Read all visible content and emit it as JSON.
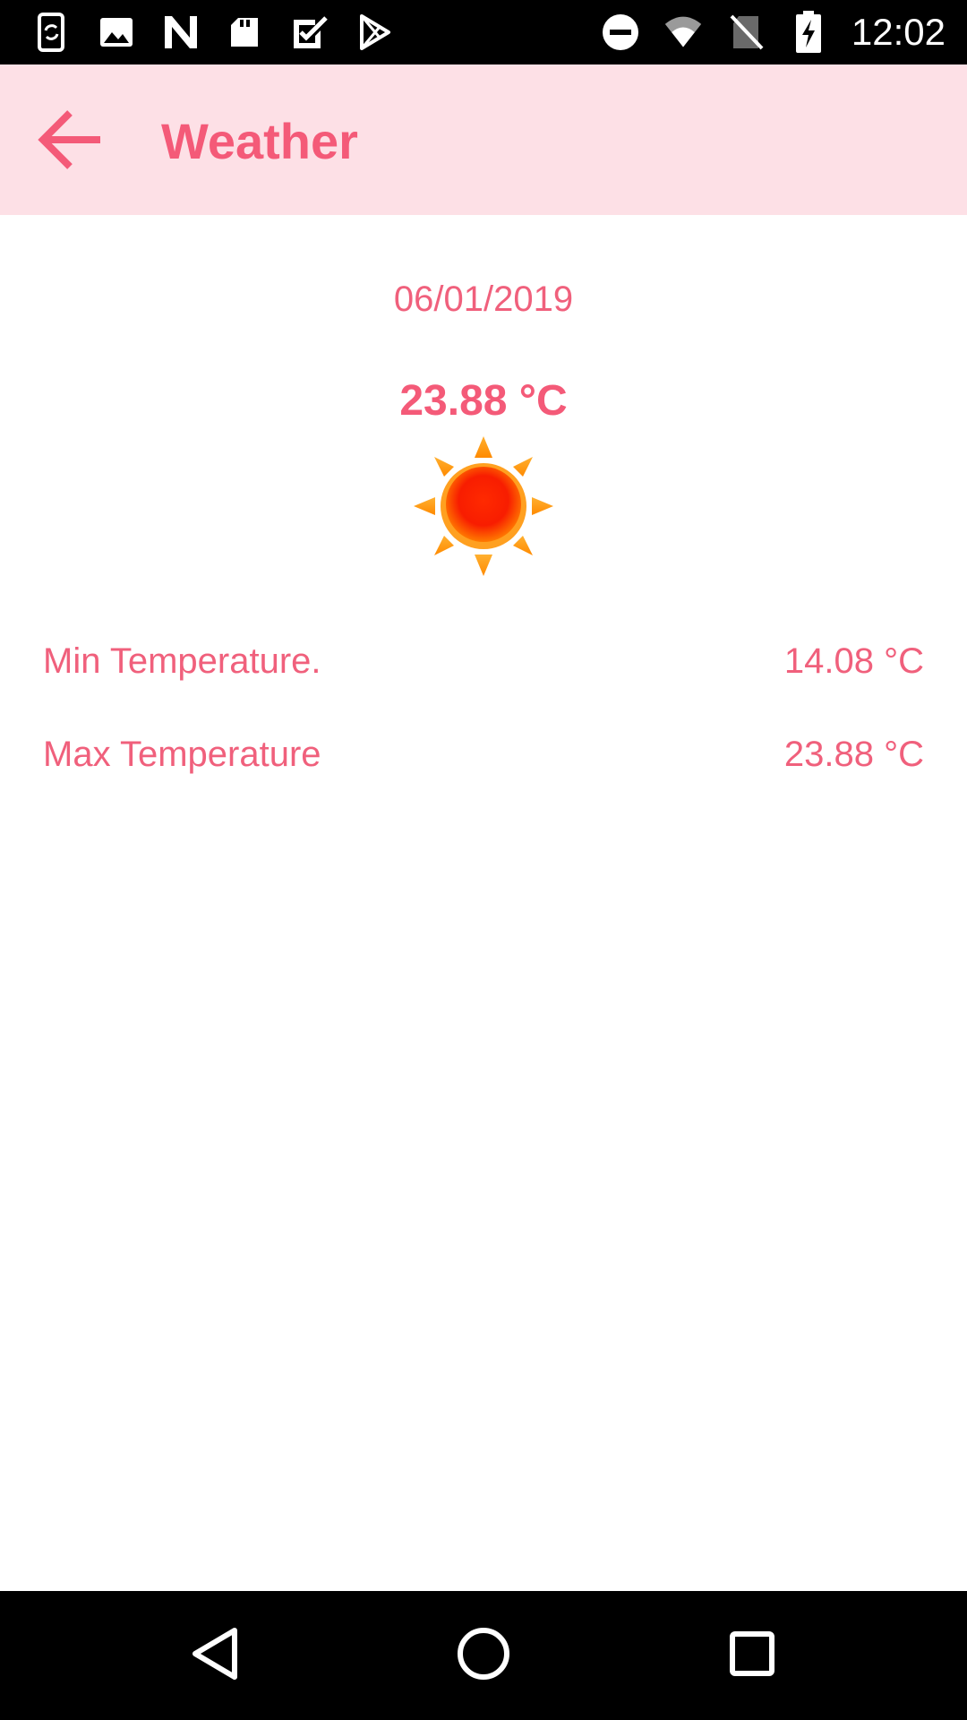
{
  "status_bar": {
    "time": "12:02",
    "left_icons": [
      "phone-sync-icon",
      "image-icon",
      "n-logo-icon",
      "sd-card-icon",
      "checkbox-icon",
      "play-store-icon"
    ],
    "right_icons": [
      "do-not-disturb-icon",
      "wifi-icon",
      "no-sim-icon",
      "battery-charging-icon"
    ]
  },
  "app_bar": {
    "back_icon": "arrow-back-icon",
    "title": "Weather"
  },
  "weather": {
    "date": "06/01/2019",
    "current_temp": "23.88 °C",
    "condition_icon": "sun-icon",
    "rows": [
      {
        "label": "Min Temperature.",
        "value": "14.08 °C"
      },
      {
        "label": "Max Temperature",
        "value": "23.88 °C"
      }
    ]
  },
  "nav_bar": {
    "icons": [
      "nav-back-icon",
      "nav-home-icon",
      "nav-recents-icon"
    ]
  },
  "colors": {
    "accent": "#f45a78",
    "app_bar_bg": "#fde0e6",
    "text": "#f0607c",
    "system_bars": "#000000"
  }
}
